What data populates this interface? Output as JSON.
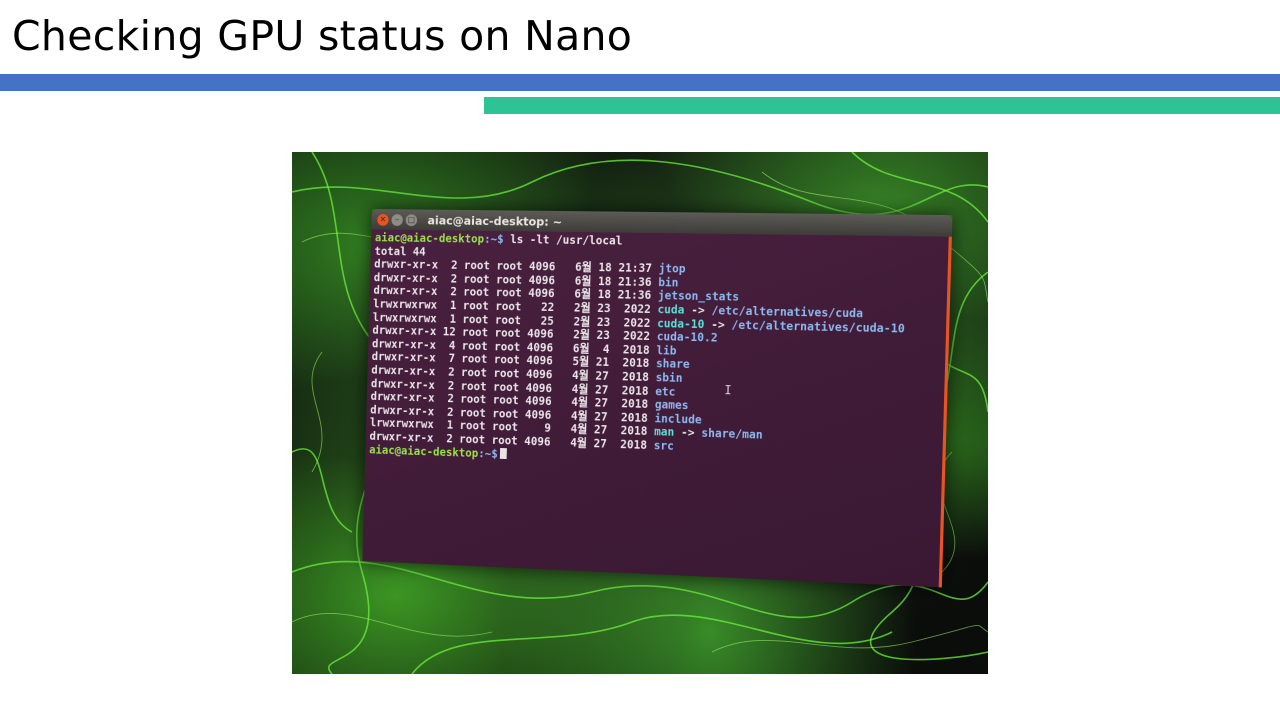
{
  "slide": {
    "title": "Checking GPU status on Nano",
    "colors": {
      "bar_top": "#4472c4",
      "bar_bottom": "#2ec394"
    }
  },
  "terminal": {
    "window_title": "aiac@aiac-desktop: ~",
    "prompt_user": "aiac@aiac-desktop",
    "prompt_path": ":~$",
    "command": " ls -lt /usr/local",
    "total": "total 44",
    "rows": [
      {
        "perms": "drwxr-xr-x",
        "links": "2",
        "owner": "root",
        "group": "root",
        "size": "4096",
        "month": "6월",
        "day": "18",
        "time": "21:37",
        "name": "jtop",
        "target": ""
      },
      {
        "perms": "drwxr-xr-x",
        "links": "2",
        "owner": "root",
        "group": "root",
        "size": "4096",
        "month": "6월",
        "day": "18",
        "time": "21:36",
        "name": "bin",
        "target": ""
      },
      {
        "perms": "drwxr-xr-x",
        "links": "2",
        "owner": "root",
        "group": "root",
        "size": "4096",
        "month": "6월",
        "day": "18",
        "time": "21:36",
        "name": "jetson_stats",
        "target": ""
      },
      {
        "perms": "lrwxrwxrwx",
        "links": "1",
        "owner": "root",
        "group": "root",
        "size": "22",
        "month": "2월",
        "day": "23",
        "time": "2022",
        "name": "cuda",
        "target": "/etc/alternatives/cuda"
      },
      {
        "perms": "lrwxrwxrwx",
        "links": "1",
        "owner": "root",
        "group": "root",
        "size": "25",
        "month": "2월",
        "day": "23",
        "time": "2022",
        "name": "cuda-10",
        "target": "/etc/alternatives/cuda-10"
      },
      {
        "perms": "drwxr-xr-x",
        "links": "12",
        "owner": "root",
        "group": "root",
        "size": "4096",
        "month": "2월",
        "day": "23",
        "time": "2022",
        "name": "cuda-10.2",
        "target": ""
      },
      {
        "perms": "drwxr-xr-x",
        "links": "4",
        "owner": "root",
        "group": "root",
        "size": "4096",
        "month": "6월",
        "day": "4",
        "time": "2018",
        "name": "lib",
        "target": ""
      },
      {
        "perms": "drwxr-xr-x",
        "links": "7",
        "owner": "root",
        "group": "root",
        "size": "4096",
        "month": "5월",
        "day": "21",
        "time": "2018",
        "name": "share",
        "target": ""
      },
      {
        "perms": "drwxr-xr-x",
        "links": "2",
        "owner": "root",
        "group": "root",
        "size": "4096",
        "month": "4월",
        "day": "27",
        "time": "2018",
        "name": "sbin",
        "target": ""
      },
      {
        "perms": "drwxr-xr-x",
        "links": "2",
        "owner": "root",
        "group": "root",
        "size": "4096",
        "month": "4월",
        "day": "27",
        "time": "2018",
        "name": "etc",
        "target": ""
      },
      {
        "perms": "drwxr-xr-x",
        "links": "2",
        "owner": "root",
        "group": "root",
        "size": "4096",
        "month": "4월",
        "day": "27",
        "time": "2018",
        "name": "games",
        "target": ""
      },
      {
        "perms": "drwxr-xr-x",
        "links": "2",
        "owner": "root",
        "group": "root",
        "size": "4096",
        "month": "4월",
        "day": "27",
        "time": "2018",
        "name": "include",
        "target": ""
      },
      {
        "perms": "lrwxrwxrwx",
        "links": "1",
        "owner": "root",
        "group": "root",
        "size": "9",
        "month": "4월",
        "day": "27",
        "time": "2018",
        "name": "man",
        "target": "share/man"
      },
      {
        "perms": "drwxr-xr-x",
        "links": "2",
        "owner": "root",
        "group": "root",
        "size": "4096",
        "month": "4월",
        "day": "27",
        "time": "2018",
        "name": "src",
        "target": ""
      }
    ],
    "colors": {
      "background": "#421c39",
      "accent": "#e95420",
      "prompt_user": "#9be34a",
      "prompt_path": "#8fb7f0",
      "directory": "#8cbaf2",
      "symlink": "#5ce0d8",
      "text": "#ebe6ea"
    }
  }
}
